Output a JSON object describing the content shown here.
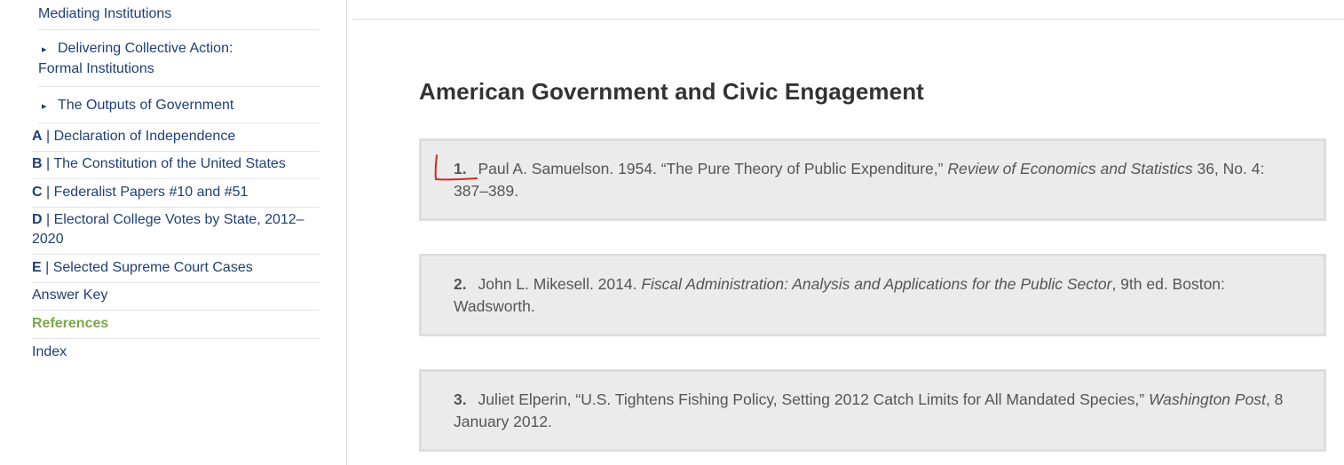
{
  "sidebar": {
    "items": [
      {
        "label": "Mediating Institutions"
      },
      {
        "label_line1": "Delivering Collective Action:",
        "label_line2": "Formal Institutions"
      },
      {
        "label": "The Outputs of Government"
      },
      {
        "letter": "A",
        "label": "| Declaration of Independence"
      },
      {
        "letter": "B",
        "label": "| The Constitution of the United States"
      },
      {
        "letter": "C",
        "label": "| Federalist Papers #10 and #51"
      },
      {
        "letter": "D",
        "label_line1": "| Electoral College Votes by State, 2012–",
        "label_line2": "2020"
      },
      {
        "letter": "E",
        "label": "| Selected Supreme Court Cases"
      },
      {
        "label": "Answer Key"
      },
      {
        "label": "References"
      },
      {
        "label": "Index"
      }
    ],
    "active_color": "#78a849",
    "link_color": "#1e3f77"
  },
  "main": {
    "title": "American Government and Civic Engagement",
    "references": [
      {
        "num": "1.",
        "text_before": "Paul A. Samuelson. 1954. “The Pure Theory of Public Expenditure,” ",
        "italic": "Review of Economics and Statistics",
        "text_after": " 36, No. 4: 387–389."
      },
      {
        "num": "2.",
        "text_before": "John L. Mikesell. 2014. ",
        "italic": "Fiscal Administration: Analysis and Applications for the Public Sector",
        "text_after": ", 9th ed. Boston: Wadsworth."
      },
      {
        "num": "3.",
        "text_before": "Juliet Elperin, “U.S. Tightens Fishing Policy, Setting 2012 Catch Limits for All Mandated Species,” ",
        "italic": "Washington Post",
        "text_after": ", 8 January 2012."
      }
    ],
    "annotation_color": "#d9261c"
  }
}
